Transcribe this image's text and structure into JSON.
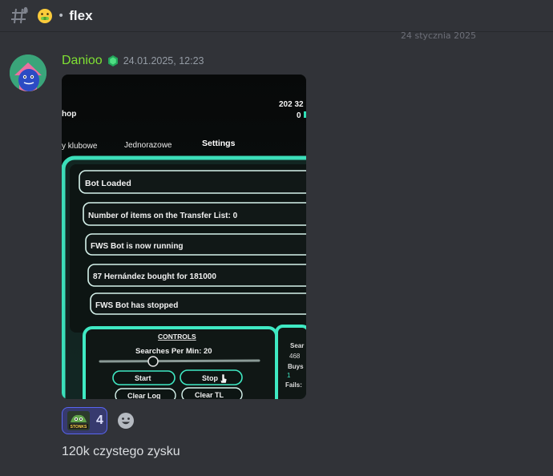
{
  "channel": {
    "name": "flex",
    "separator": "•",
    "emoji_icon": "money-mouth-face-icon"
  },
  "date_divider": "24 stycznia 2025",
  "message": {
    "author": "Danioo",
    "author_color": "#7fe033",
    "role_icon": "green-gem-icon",
    "timestamp": "24.01.2025, 12:23",
    "text": "120k czystego zysku",
    "reactions": [
      {
        "emoji": "stonks-emoji",
        "emoji_label": "STONKS",
        "count": "4"
      }
    ]
  },
  "attachment_photo": {
    "top_right_numbers": "202 32",
    "top_right_small": "0",
    "tab_partial": "hop",
    "tabs": [
      "y klubowe",
      "Jednorazowe",
      "Settings"
    ],
    "log_lines": [
      "Bot Loaded",
      "Number of items on the Transfer List: 0",
      "FWS Bot is now running",
      "87 Hernández bought for 181000",
      "FWS Bot has stopped"
    ],
    "controls_title": "CONTROLS",
    "searches_label": "Searches Per Min: 20",
    "buttons": [
      "Start",
      "Stop",
      "Clear Log",
      "Clear TL"
    ],
    "side_stats": [
      "Sear",
      "468",
      "Buys",
      "1",
      "Fails:"
    ]
  }
}
